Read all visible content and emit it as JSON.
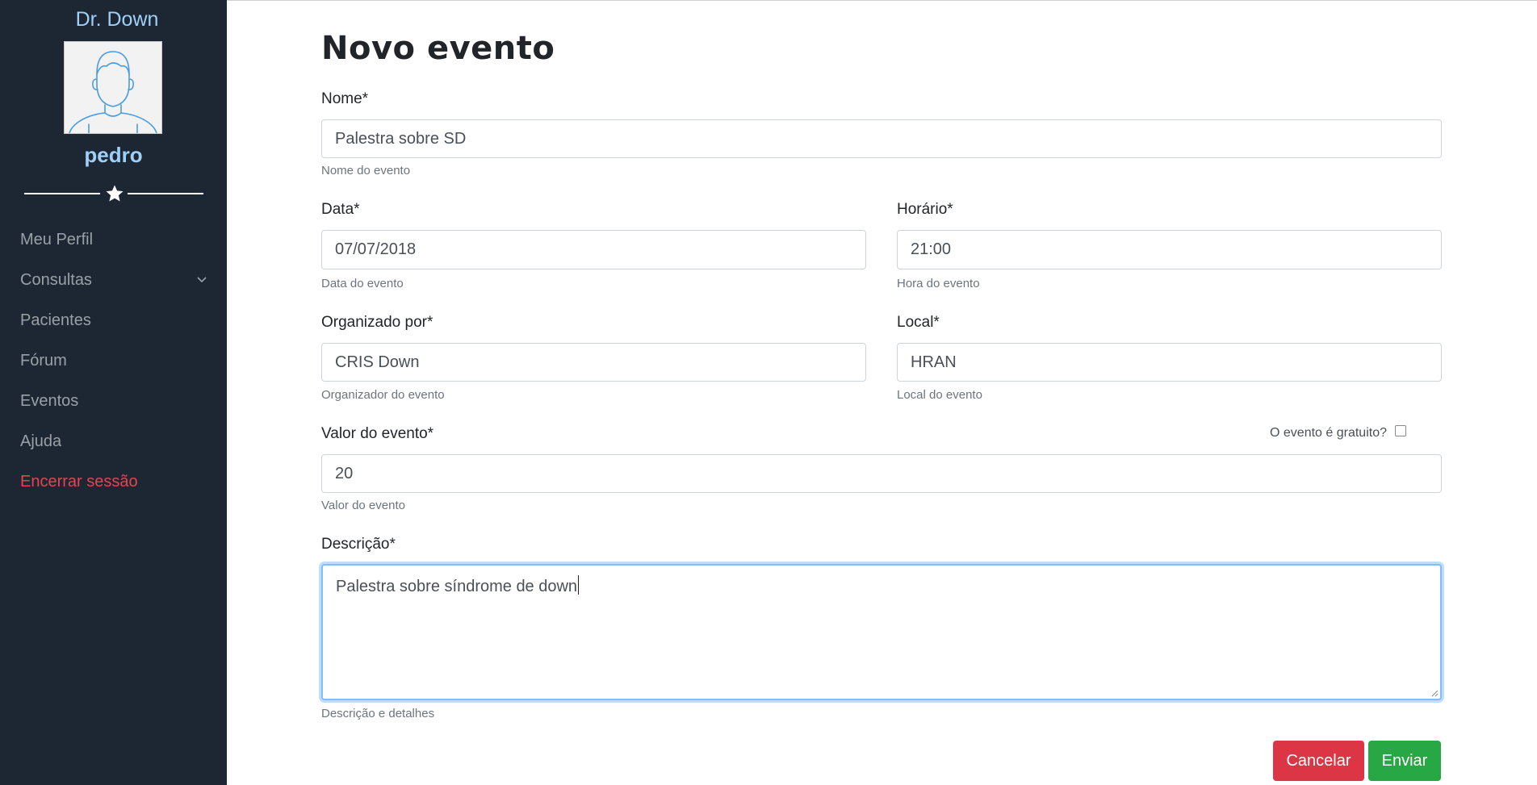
{
  "sidebar": {
    "brand": "Dr. Down",
    "username": "pedro",
    "items": [
      {
        "label": "Meu Perfil"
      },
      {
        "label": "Consultas"
      },
      {
        "label": "Pacientes"
      },
      {
        "label": "Fórum"
      },
      {
        "label": "Eventos"
      },
      {
        "label": "Ajuda"
      },
      {
        "label": "Encerrar sessão"
      }
    ],
    "icons": {
      "avatar": "user-avatar-icon",
      "divider": "star-icon",
      "dropdown": "chevron-down-icon"
    }
  },
  "form": {
    "title": "Novo evento",
    "nome": {
      "label": "Nome*",
      "value": "Palestra sobre SD",
      "help": "Nome do evento"
    },
    "data": {
      "label": "Data*",
      "value": "07/07/2018",
      "help": "Data do evento"
    },
    "horario": {
      "label": "Horário*",
      "value": "21:00",
      "help": "Hora do evento"
    },
    "organizado": {
      "label": "Organizado por*",
      "value": "CRIS Down",
      "help": "Organizador do evento"
    },
    "local": {
      "label": "Local*",
      "value": "HRAN",
      "help": "Local do evento"
    },
    "valor": {
      "label": "Valor do evento*",
      "value": "20",
      "help": "Valor do evento"
    },
    "gratuito": {
      "label": "O evento é gratuito?",
      "checked": false
    },
    "descricao": {
      "label": "Descrição*",
      "value": "Palestra sobre síndrome de down",
      "help": "Descrição e detalhes"
    },
    "buttons": {
      "cancel": "Cancelar",
      "submit": "Enviar"
    }
  },
  "colors": {
    "sidebar_bg": "#1d2733",
    "accent_blue": "#9fd0f7",
    "danger": "#dc3545",
    "success": "#28a745",
    "logout_text": "#e8424f"
  }
}
